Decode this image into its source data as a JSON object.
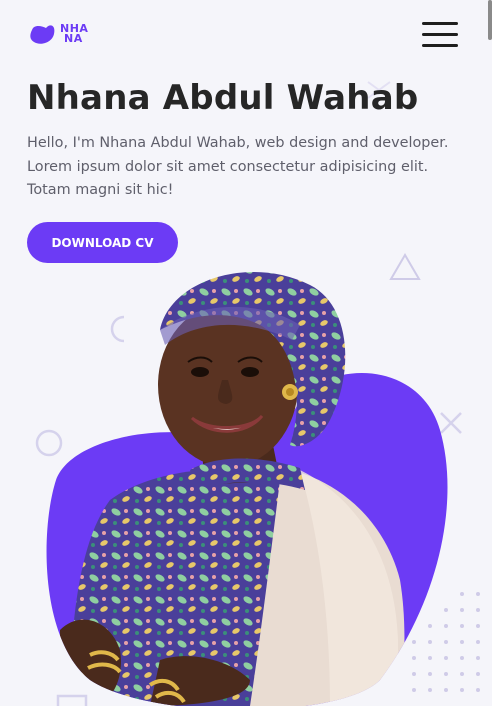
{
  "header": {
    "logo_line1": "NHA",
    "logo_line2": "NA",
    "menu_icon": "hamburger-menu-icon",
    "brand_color": "#6c3bf5"
  },
  "hero": {
    "title": "Nhana Abdul Wahab",
    "description": "Hello, I'm Nhana Abdul Wahab, web design and developer. Lorem ipsum dolor sit amet consectetur adipisicing elit. Totam magni sit hic!",
    "cta_label": "DOWNLOAD CV",
    "portrait_alt": "portrait-photo"
  },
  "colors": {
    "accent": "#6c3bf5",
    "background": "#f5f5fa",
    "heading": "#262626",
    "body_text": "#5f5f6b",
    "decor": "#d9d6ef"
  }
}
